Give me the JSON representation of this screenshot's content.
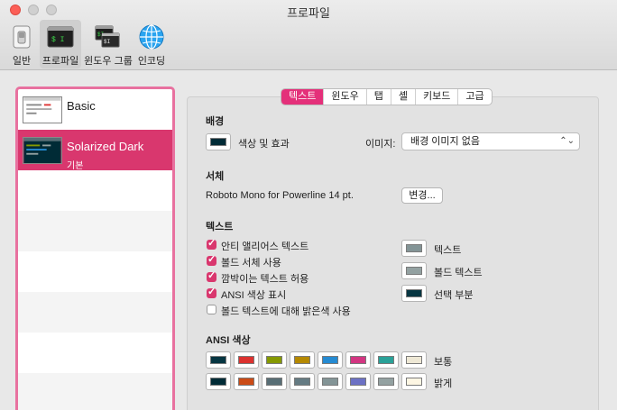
{
  "window": {
    "title": "프로파일"
  },
  "toolbar": {
    "items": [
      {
        "label": "일반",
        "icon": "switch-icon"
      },
      {
        "label": "프로파일",
        "icon": "terminal-profile-icon",
        "active": true
      },
      {
        "label": "윈도우 그룹",
        "icon": "window-group-icon"
      },
      {
        "label": "인코딩",
        "icon": "globe-icon"
      }
    ]
  },
  "profiles": [
    {
      "name": "Basic",
      "subtitle": ""
    },
    {
      "name": "Solarized Dark",
      "subtitle": "기본",
      "selected": true
    }
  ],
  "tabs": [
    "텍스트",
    "윈도우",
    "탭",
    "셸",
    "키보드",
    "고급"
  ],
  "active_tab": "텍스트",
  "background": {
    "heading": "배경",
    "color_effects_label": "색상 및 효과",
    "image_label": "이미지:",
    "image_value": "배경 이미지 없음",
    "swatch_color": "#002b36"
  },
  "font": {
    "heading": "서체",
    "name": "Roboto Mono for Powerline 14 pt.",
    "change_button": "변경..."
  },
  "text": {
    "heading": "텍스트",
    "options": [
      {
        "label": "안티 앨리어스 텍스트",
        "checked": true
      },
      {
        "label": "볼드 서체 사용",
        "checked": true
      },
      {
        "label": "깜박이는 텍스트 허용",
        "checked": true
      },
      {
        "label": "ANSI 색상 표시",
        "checked": true
      },
      {
        "label": "볼드 텍스트에 대해 밝은색 사용",
        "checked": false
      }
    ],
    "colors": [
      {
        "label": "텍스트",
        "color": "#839496"
      },
      {
        "label": "볼드 텍스트",
        "color": "#93a1a1"
      },
      {
        "label": "선택 부분",
        "color": "#073642"
      }
    ]
  },
  "ansi": {
    "heading": "ANSI 색상",
    "normal_label": "보통",
    "bright_label": "밝게",
    "normal": [
      "#073642",
      "#dc322f",
      "#859900",
      "#b58900",
      "#268bd2",
      "#d33682",
      "#2aa198",
      "#eee8d5"
    ],
    "bright": [
      "#002b36",
      "#cb4b16",
      "#586e75",
      "#657b83",
      "#839496",
      "#6c71c4",
      "#93a1a1",
      "#fdf6e3"
    ]
  },
  "accent_color": "#d9376e"
}
